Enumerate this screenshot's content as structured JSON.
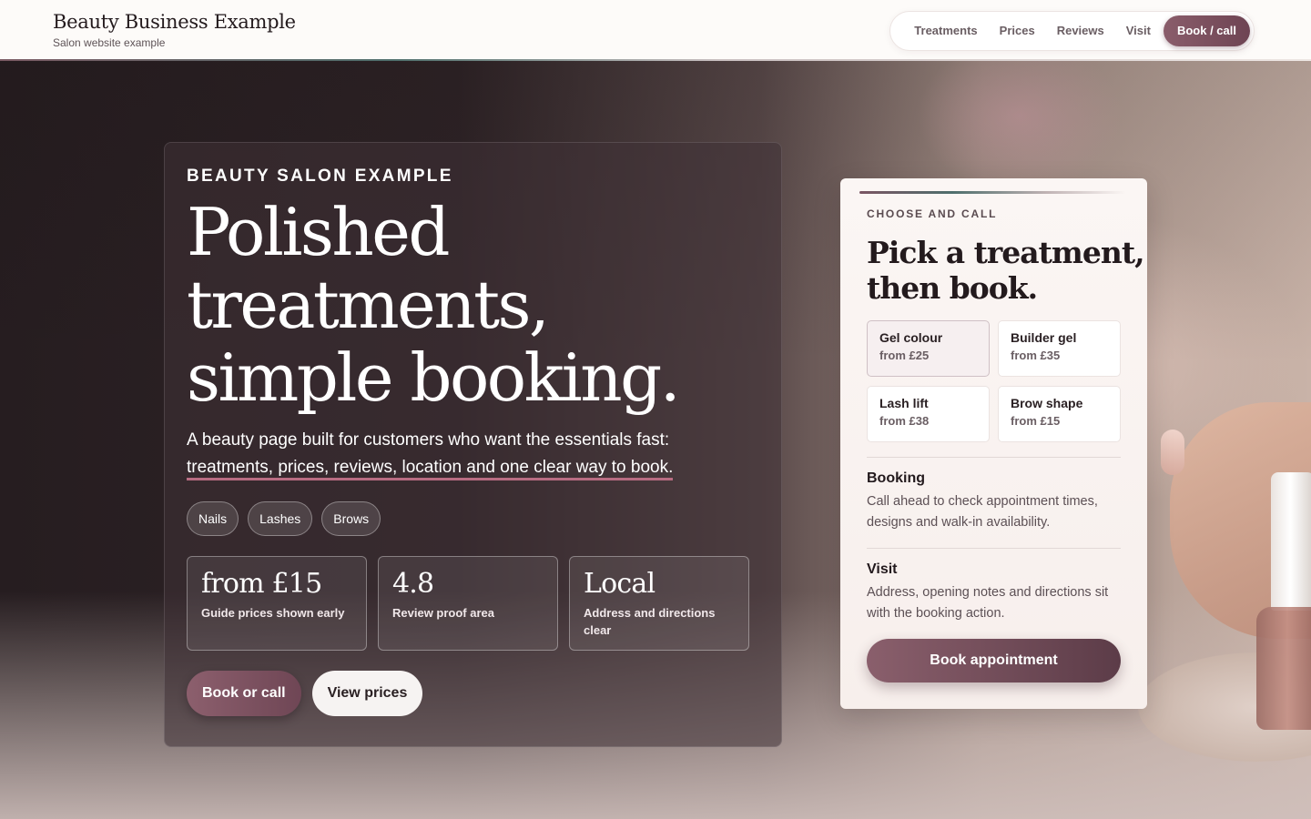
{
  "header": {
    "title": "Beauty Business Example",
    "subtitle": "Salon website example",
    "nav": {
      "treatments": "Treatments",
      "prices": "Prices",
      "reviews": "Reviews",
      "visit": "Visit",
      "cta": "Book / call"
    }
  },
  "hero": {
    "kicker": "BEAUTY SALON EXAMPLE",
    "headline": [
      "Polished",
      "treatments,",
      "simple booking."
    ],
    "lede_plain": "A beauty page built for customers who want the essentials fast: ",
    "lede_marked": "treatments, prices, reviews, location and one clear way to book.",
    "chips": [
      "Nails",
      "Lashes",
      "Brows"
    ],
    "stats": [
      {
        "value": "from £15",
        "label": "Guide prices shown early"
      },
      {
        "value": "4.8",
        "label": "Review proof area"
      },
      {
        "value": "Local",
        "label": "Address and directions clear"
      }
    ],
    "primary_button": "Book or call",
    "secondary_button": "View prices"
  },
  "booking": {
    "kicker": "CHOOSE AND CALL",
    "title": [
      "Pick a treatment,",
      "then book."
    ],
    "treatments": [
      {
        "name": "Gel colour",
        "price": "from £25",
        "selected": true
      },
      {
        "name": "Builder gel",
        "price": "from £35",
        "selected": false
      },
      {
        "name": "Lash lift",
        "price": "from £38",
        "selected": false
      },
      {
        "name": "Brow shape",
        "price": "from £15",
        "selected": false
      }
    ],
    "booking_title": "Booking",
    "booking_body": "Call ahead to check appointment times, designs and walk-in availability.",
    "visit_title": "Visit",
    "visit_body": "Address, opening notes and directions sit with the booking action.",
    "cta": "Book appointment"
  },
  "colors": {
    "accent": "#7a4f5f",
    "header_bg": "#fdfbf9",
    "panel_bg": "#fbf6f4"
  }
}
